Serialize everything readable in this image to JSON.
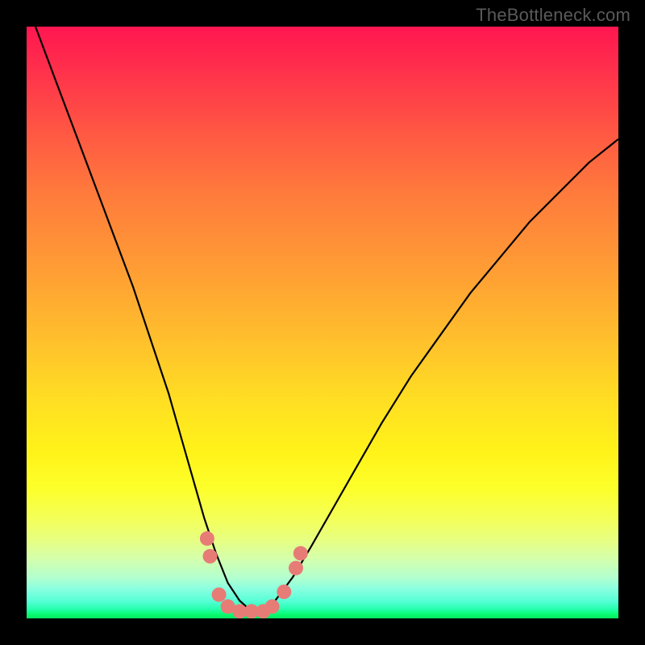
{
  "watermark": "TheBottleneck.com",
  "colors": {
    "frame": "#000000",
    "curve": "#000000",
    "markers": "#e77c77",
    "gradient_top": "#ff1650",
    "gradient_bottom": "#06e75e"
  },
  "chart_data": {
    "type": "line",
    "title": "",
    "xlabel": "",
    "ylabel": "",
    "xlim": [
      0,
      100
    ],
    "ylim": [
      0,
      100
    ],
    "series": [
      {
        "name": "bottleneck-curve",
        "x": [
          0,
          3,
          6,
          9,
          12,
          15,
          18,
          21,
          24,
          26,
          28,
          30,
          32,
          34,
          36,
          38,
          40,
          42,
          45,
          48,
          52,
          56,
          60,
          65,
          70,
          75,
          80,
          85,
          90,
          95,
          100
        ],
        "y": [
          104,
          96,
          88,
          80,
          72,
          64,
          56,
          47,
          38,
          31,
          24,
          17,
          11,
          6,
          3,
          1.2,
          1.2,
          3,
          7,
          12,
          19,
          26,
          33,
          41,
          48,
          55,
          61,
          67,
          72,
          77,
          81
        ]
      }
    ],
    "markers": [
      {
        "x": 30.5,
        "y": 13.5
      },
      {
        "x": 31.0,
        "y": 10.5
      },
      {
        "x": 32.5,
        "y": 4.0
      },
      {
        "x": 34.0,
        "y": 2.0
      },
      {
        "x": 36.0,
        "y": 1.2
      },
      {
        "x": 38.0,
        "y": 1.2
      },
      {
        "x": 40.0,
        "y": 1.2
      },
      {
        "x": 41.5,
        "y": 2.0
      },
      {
        "x": 43.5,
        "y": 4.5
      },
      {
        "x": 45.5,
        "y": 8.5
      },
      {
        "x": 46.3,
        "y": 11.0
      }
    ]
  }
}
